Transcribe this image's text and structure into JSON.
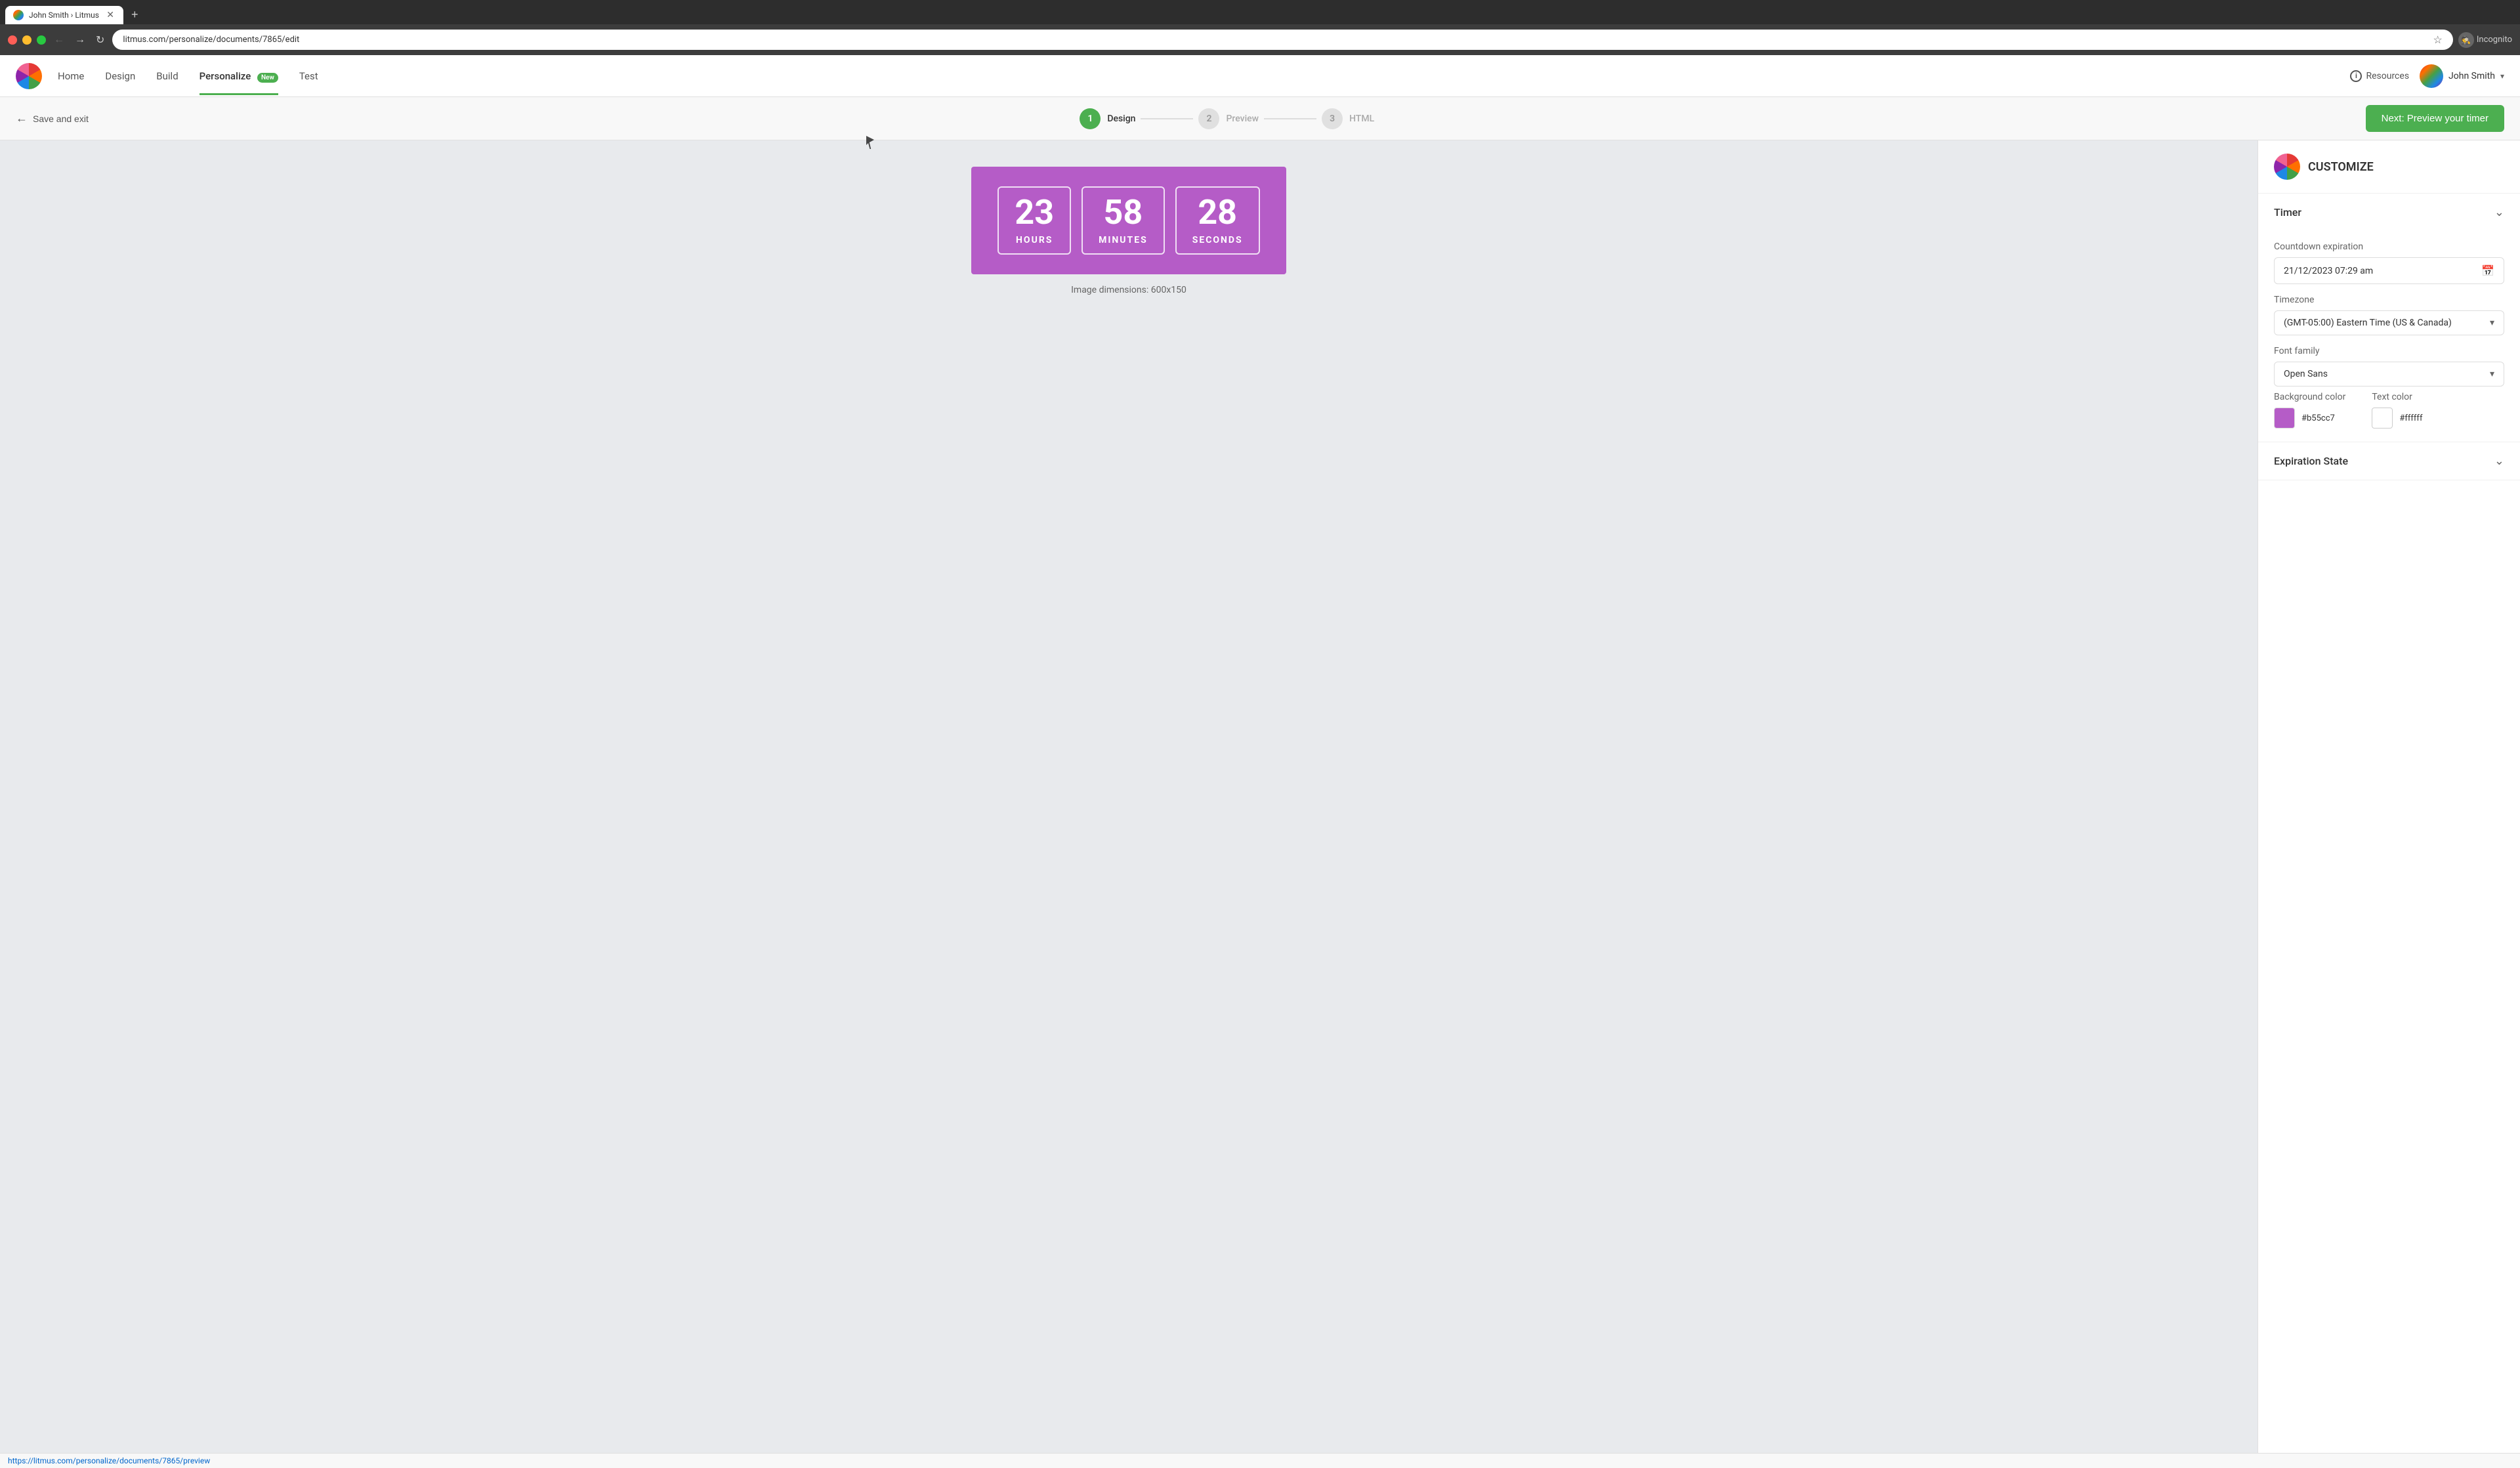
{
  "browser": {
    "tab_title": "John Smith › Litmus",
    "favicon_alt": "litmus-favicon",
    "address": "litmus.com/personalize/documents/7865/edit",
    "new_tab_label": "+",
    "incognito_label": "Incognito"
  },
  "header": {
    "logo_alt": "litmus-logo",
    "nav": {
      "home": "Home",
      "design": "Design",
      "build": "Build",
      "personalize": "Personalize",
      "personalize_badge": "New",
      "test": "Test"
    },
    "resources": "Resources",
    "user_name": "John Smith"
  },
  "toolbar": {
    "save_exit": "Save and exit",
    "steps": [
      {
        "number": "1",
        "label": "Design",
        "state": "active"
      },
      {
        "number": "2",
        "label": "Preview",
        "state": "inactive"
      },
      {
        "number": "3",
        "label": "HTML",
        "state": "inactive"
      }
    ],
    "next_button": "Next: Preview your timer"
  },
  "canvas": {
    "timer": {
      "hours": "23",
      "minutes": "58",
      "seconds": "28",
      "hours_label": "HOURS",
      "minutes_label": "MINUTES",
      "seconds_label": "SECONDS"
    },
    "image_dimensions": "Image dimensions: 600x150"
  },
  "sidebar": {
    "title": "CUSTOMIZE",
    "logo_alt": "litmus-sidebar-logo",
    "timer_section": {
      "title": "Timer",
      "countdown_label": "Countdown expiration",
      "countdown_value": "21/12/2023 07:29 am",
      "timezone_label": "Timezone",
      "timezone_value": "(GMT-05:00) Eastern Time (US & Canada)",
      "font_family_label": "Font family",
      "font_family_value": "Open Sans",
      "background_color_label": "Background color",
      "background_color_hex": "#b55cc7",
      "background_color_swatch": "#b55cc7",
      "text_color_label": "Text color",
      "text_color_hex": "#ffffff",
      "text_color_swatch": "#ffffff"
    },
    "expiration_section": {
      "title": "Expiration State"
    }
  },
  "status_bar": {
    "url": "https://litmus.com/personalize/documents/7865/preview"
  }
}
